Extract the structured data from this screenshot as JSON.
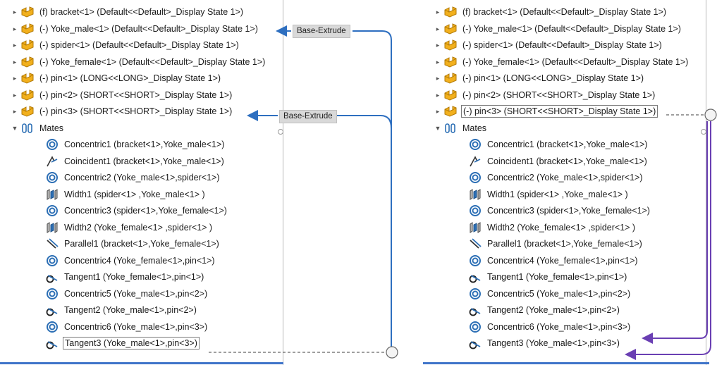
{
  "left_panel": {
    "components": [
      {
        "label": "(f) bracket<1> (Default<<Default>_Display State 1>)",
        "icon": "part-icon"
      },
      {
        "label": "(-) Yoke_male<1> (Default<<Default>_Display State 1>)",
        "icon": "part-icon"
      },
      {
        "label": "(-) spider<1> (Default<<Default>_Display State 1>)",
        "icon": "part-icon"
      },
      {
        "label": "(-) Yoke_female<1> (Default<<Default>_Display State 1>)",
        "icon": "part-icon"
      },
      {
        "label": "(-) pin<1> (LONG<<LONG>_Display State 1>)",
        "icon": "part-icon"
      },
      {
        "label": "(-) pin<2> (SHORT<<SHORT>_Display State 1>)",
        "icon": "part-icon"
      },
      {
        "label": "(-) pin<3> (SHORT<<SHORT>_Display State 1>)",
        "icon": "part-icon"
      }
    ],
    "mates_folder": "Mates",
    "mates": [
      {
        "label": "Concentric1 (bracket<1>,Yoke_male<1>)",
        "icon": "concentric-icon"
      },
      {
        "label": "Coincident1 (bracket<1>,Yoke_male<1>)",
        "icon": "coincident-icon"
      },
      {
        "label": "Concentric2 (Yoke_male<1>,spider<1>)",
        "icon": "concentric-icon"
      },
      {
        "label": "Width1 (spider<1> ,Yoke_male<1> )",
        "icon": "width-icon"
      },
      {
        "label": "Concentric3 (spider<1>,Yoke_female<1>)",
        "icon": "concentric-icon"
      },
      {
        "label": "Width2 (Yoke_female<1> ,spider<1> )",
        "icon": "width-icon"
      },
      {
        "label": "Parallel1 (bracket<1>,Yoke_female<1>)",
        "icon": "parallel-icon"
      },
      {
        "label": "Concentric4 (Yoke_female<1>,pin<1>)",
        "icon": "concentric-icon"
      },
      {
        "label": "Tangent1 (Yoke_female<1>,pin<1>)",
        "icon": "tangent-icon"
      },
      {
        "label": "Concentric5 (Yoke_male<1>,pin<2>)",
        "icon": "concentric-icon"
      },
      {
        "label": "Tangent2 (Yoke_male<1>,pin<2>)",
        "icon": "tangent-icon"
      },
      {
        "label": "Concentric6 (Yoke_male<1>,pin<3>)",
        "icon": "concentric-icon"
      },
      {
        "label": "Tangent3 (Yoke_male<1>,pin<3>)",
        "icon": "tangent-icon",
        "selected": true
      }
    ],
    "callouts": [
      "Base-Extrude",
      "Base-Extrude"
    ]
  },
  "right_panel": {
    "components": [
      {
        "label": "(f) bracket<1> (Default<<Default>_Display State 1>)",
        "icon": "part-icon"
      },
      {
        "label": "(-) Yoke_male<1> (Default<<Default>_Display State 1>)",
        "icon": "part-icon"
      },
      {
        "label": "(-) spider<1> (Default<<Default>_Display State 1>)",
        "icon": "part-icon"
      },
      {
        "label": "(-) Yoke_female<1> (Default<<Default>_Display State 1>)",
        "icon": "part-icon"
      },
      {
        "label": "(-) pin<1> (LONG<<LONG>_Display State 1>)",
        "icon": "part-icon"
      },
      {
        "label": "(-) pin<2> (SHORT<<SHORT>_Display State 1>)",
        "icon": "part-icon"
      },
      {
        "label": "(-) pin<3> (SHORT<<SHORT>_Display State 1>)",
        "icon": "part-icon",
        "selected": true
      }
    ],
    "mates_folder": "Mates",
    "mates": [
      {
        "label": "Concentric1 (bracket<1>,Yoke_male<1>)",
        "icon": "concentric-icon"
      },
      {
        "label": "Coincident1 (bracket<1>,Yoke_male<1>)",
        "icon": "coincident-icon"
      },
      {
        "label": "Concentric2 (Yoke_male<1>,spider<1>)",
        "icon": "concentric-icon"
      },
      {
        "label": "Width1 (spider<1> ,Yoke_male<1> )",
        "icon": "width-icon"
      },
      {
        "label": "Concentric3 (spider<1>,Yoke_female<1>)",
        "icon": "concentric-icon"
      },
      {
        "label": "Width2 (Yoke_female<1> ,spider<1> )",
        "icon": "width-icon"
      },
      {
        "label": "Parallel1 (bracket<1>,Yoke_female<1>)",
        "icon": "parallel-icon"
      },
      {
        "label": "Concentric4 (Yoke_female<1>,pin<1>)",
        "icon": "concentric-icon"
      },
      {
        "label": "Tangent1 (Yoke_female<1>,pin<1>)",
        "icon": "tangent-icon"
      },
      {
        "label": "Concentric5 (Yoke_male<1>,pin<2>)",
        "icon": "concentric-icon"
      },
      {
        "label": "Tangent2 (Yoke_male<1>,pin<2>)",
        "icon": "tangent-icon"
      },
      {
        "label": "Concentric6 (Yoke_male<1>,pin<3>)",
        "icon": "concentric-icon"
      },
      {
        "label": "Tangent3 (Yoke_male<1>,pin<3>)",
        "icon": "tangent-icon"
      }
    ]
  },
  "colors": {
    "left_arrows": "#2e6fc0",
    "right_arrows": "#6a3fb3",
    "panel_bottom_bar": "#3f74c9",
    "part_icon": "#f2b01d"
  }
}
